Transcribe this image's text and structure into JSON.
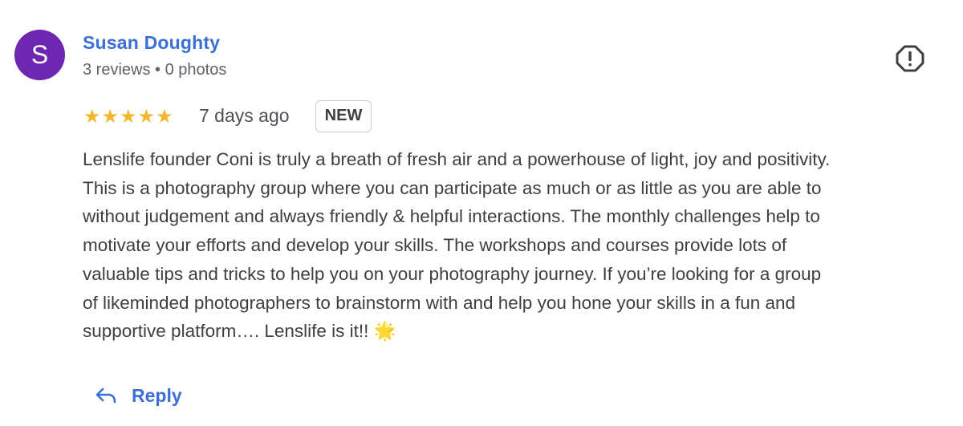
{
  "reviewer": {
    "avatar_letter": "S",
    "avatar_color": "#6e27b0",
    "name": "Susan Doughty",
    "meta": "3 reviews • 0 photos"
  },
  "rating": {
    "stars": "★★★★★",
    "value": 5,
    "max": 5,
    "star_color": "#f3b62d"
  },
  "date": "7 days ago",
  "badge": "NEW",
  "review_text": "Lenslife founder Coni is truly a breath of fresh air and a powerhouse of light, joy and positivity.\nThis is a photography group where you can participate as much or as little as you are able to\nwithout judgement and always friendly & helpful interactions. The monthly challenges help to\nmotivate your efforts and develop your skills. The workshops and courses provide lots of\nvaluable tips and tricks to help you on your photography journey. If you’re looking for a group\nof likeminded photographers to brainstorm with and help you hone your skills in a fun and\nsupportive platform…. Lenslife is it!! 🌟",
  "actions": {
    "reply_label": "Reply",
    "report_icon": "report-flag-icon"
  },
  "colors": {
    "link": "#3b6fd6",
    "text": "#3c4043",
    "muted": "#5f6368"
  }
}
